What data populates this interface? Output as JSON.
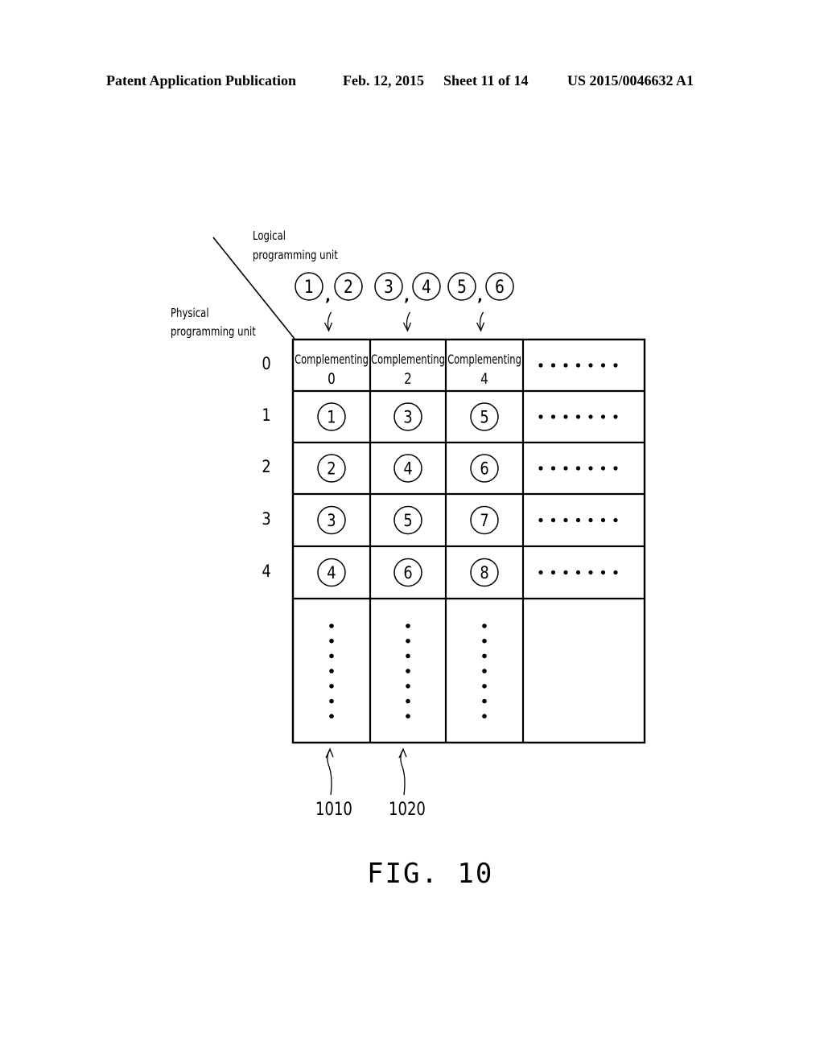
{
  "header": {
    "publication": "Patent Application Publication",
    "date": "Feb. 12, 2015",
    "sheet": "Sheet 11 of 14",
    "number": "US 2015/0046632 A1"
  },
  "diagram": {
    "logical_label_line1": "Logical",
    "logical_label_line2": "programming unit",
    "physical_label_line1": "Physical",
    "physical_label_line2": "programming unit",
    "logical_groups": [
      {
        "a": "1",
        "b": "2"
      },
      {
        "a": "3",
        "b": "4"
      },
      {
        "a": "5",
        "b": "6"
      }
    ],
    "row_labels": [
      "0",
      "1",
      "2",
      "3",
      "4"
    ],
    "complement_label": "Complementing",
    "complement_values": [
      "0",
      "2",
      "4"
    ],
    "cells": [
      [
        "1",
        "3",
        "5"
      ],
      [
        "2",
        "4",
        "6"
      ],
      [
        "3",
        "5",
        "7"
      ],
      [
        "4",
        "6",
        "8"
      ]
    ],
    "ellipsis_columns": 3,
    "references": [
      "1010",
      "1020"
    ]
  },
  "figure_label": "FIG. 10"
}
